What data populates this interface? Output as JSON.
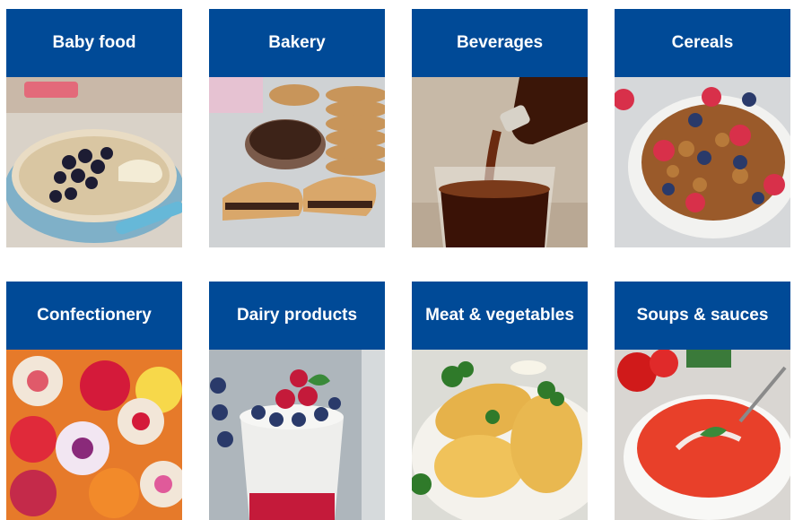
{
  "categories": [
    {
      "label": "Baby food",
      "image": "oatmeal-with-blueberries-photo"
    },
    {
      "label": "Bakery",
      "image": "wafers-and-chocolate-spread-photo"
    },
    {
      "label": "Beverages",
      "image": "cola-pouring-into-glass-photo"
    },
    {
      "label": "Cereals",
      "image": "granola-with-berries-photo"
    },
    {
      "label": "Confectionery",
      "image": "colorful-hard-candies-photo"
    },
    {
      "label": "Dairy products",
      "image": "yogurt-parfait-with-berries-photo"
    },
    {
      "label": "Meat & vegetables",
      "image": "breaded-cutlets-with-parsley-photo"
    },
    {
      "label": "Soups & sauces",
      "image": "tomato-soup-bowl-photo"
    }
  ],
  "colors": {
    "header_bg": "#004a97",
    "header_text": "#ffffff"
  }
}
